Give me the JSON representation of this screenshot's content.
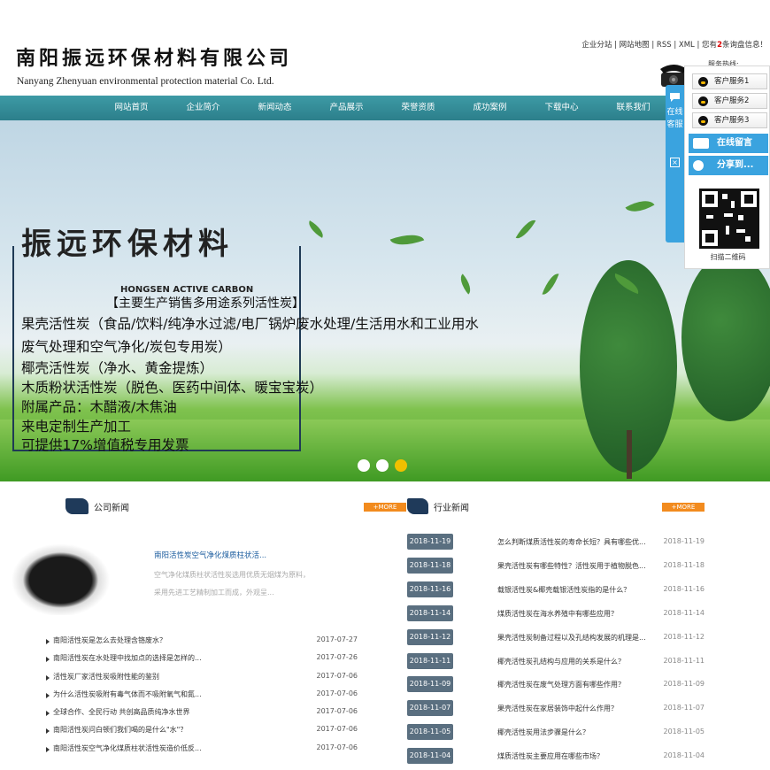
{
  "header": {
    "company_cn": "南阳振远环保材料有限公司",
    "company_en": "Nanyang Zhenyuan environmental protection material Co. Ltd.",
    "top_links": "企业分站 | 网站地图 | RSS | XML | 您有",
    "inquiry_count": "2",
    "inquiry_suffix": "条询盘信息！",
    "hotline_label": "服务热线:"
  },
  "nav": {
    "items": [
      "网站首页",
      "企业简介",
      "新闻动态",
      "产品展示",
      "荣誉资质",
      "成功案例",
      "下载中心",
      "联系我们"
    ]
  },
  "banner": {
    "title": "振远环保材料",
    "subtitle_en": "HONGSEN ACTIVE CARBON",
    "lines": [
      "【主要生产销售多用途系列活性炭】",
      "果壳活性炭（食品/饮料/纯净水过滤/电厂锅炉废水处理/生活用水和工业用水",
      "废气处理和空气净化/炭包专用炭）",
      "椰壳活性炭（净水、黄金提炼）",
      "木质粉状活性炭（脱色、医药中间体、暖宝宝炭）",
      "附属产品：木醋液/木焦油",
      "来电定制生产加工",
      "可提供17%增值税专用发票"
    ],
    "active_slide": 3
  },
  "side_float": {
    "tab_label": "在线客服",
    "close_icon": "×",
    "qq_items": [
      "客户服务1",
      "客户服务2",
      "客户服务3"
    ],
    "message_btn": "在线留言",
    "share_btn": "分享到...",
    "qr_caption": "扫描二维码",
    "accent": "#3aa3df"
  },
  "company_news": {
    "title": "公司新闻",
    "more": "+MORE",
    "featured_title": "南阳活性炭空气净化煤质柱状活...",
    "featured_desc": "空气净化煤质柱状活性炭选用优质无烟煤为原料，采用先进工艺精制加工而成，外观呈...",
    "items": [
      {
        "title": "南阳活性炭是怎么去处理含铬废水？",
        "date": "2017-07-27"
      },
      {
        "title": "南阳活性炭在水处理中找加点的选择是怎样的...",
        "date": "2017-07-26"
      },
      {
        "title": "活性炭厂家活性炭吸附性能的鉴别",
        "date": "2017-07-06"
      },
      {
        "title": "为什么活性炭吸附有毒气体而不吸附氧气和氮...",
        "date": "2017-07-06"
      },
      {
        "title": "全球合作、全民行动 共创高品质纯净水世界",
        "date": "2017-07-06"
      },
      {
        "title": "南阳活性炭问白顿们我们喝的是什么\"水\"？",
        "date": "2017-07-06"
      },
      {
        "title": "南阳活性炭空气净化煤质柱状活性炭造价低反...",
        "date": "2017-07-06"
      }
    ]
  },
  "industry_news": {
    "title": "行业新闻",
    "more": "+MORE",
    "items": [
      {
        "badge": "2018-11-19",
        "title": "怎么判断煤质活性炭的寿命长短？具有哪些优...",
        "date": "2018-11-19"
      },
      {
        "badge": "2018-11-18",
        "title": "果壳活性炭有哪些特性？活性炭用于植物脱色...",
        "date": "2018-11-18"
      },
      {
        "badge": "2018-11-16",
        "title": "载银活性炭&椰壳载银活性炭指的是什么？",
        "date": "2018-11-16"
      },
      {
        "badge": "2018-11-14",
        "title": "煤质活性炭在海水养殖中有哪些应用？",
        "date": "2018-11-14"
      },
      {
        "badge": "2018-11-12",
        "title": "果壳活性炭制备过程以及孔结构发展的机理是...",
        "date": "2018-11-12"
      },
      {
        "badge": "2018-11-11",
        "title": "椰壳活性炭孔结构与应用的关系是什么？",
        "date": "2018-11-11"
      },
      {
        "badge": "2018-11-09",
        "title": "椰壳活性炭在废气处理方面有哪些作用？",
        "date": "2018-11-09"
      },
      {
        "badge": "2018-11-07",
        "title": "果壳活性炭在家居装饰中起什么作用？",
        "date": "2018-11-07"
      },
      {
        "badge": "2018-11-05",
        "title": "椰壳活性炭用法步骤是什么？",
        "date": "2018-11-05"
      },
      {
        "badge": "2018-11-04",
        "title": "煤质活性炭主要应用在哪些市场？",
        "date": "2018-11-04"
      }
    ]
  }
}
